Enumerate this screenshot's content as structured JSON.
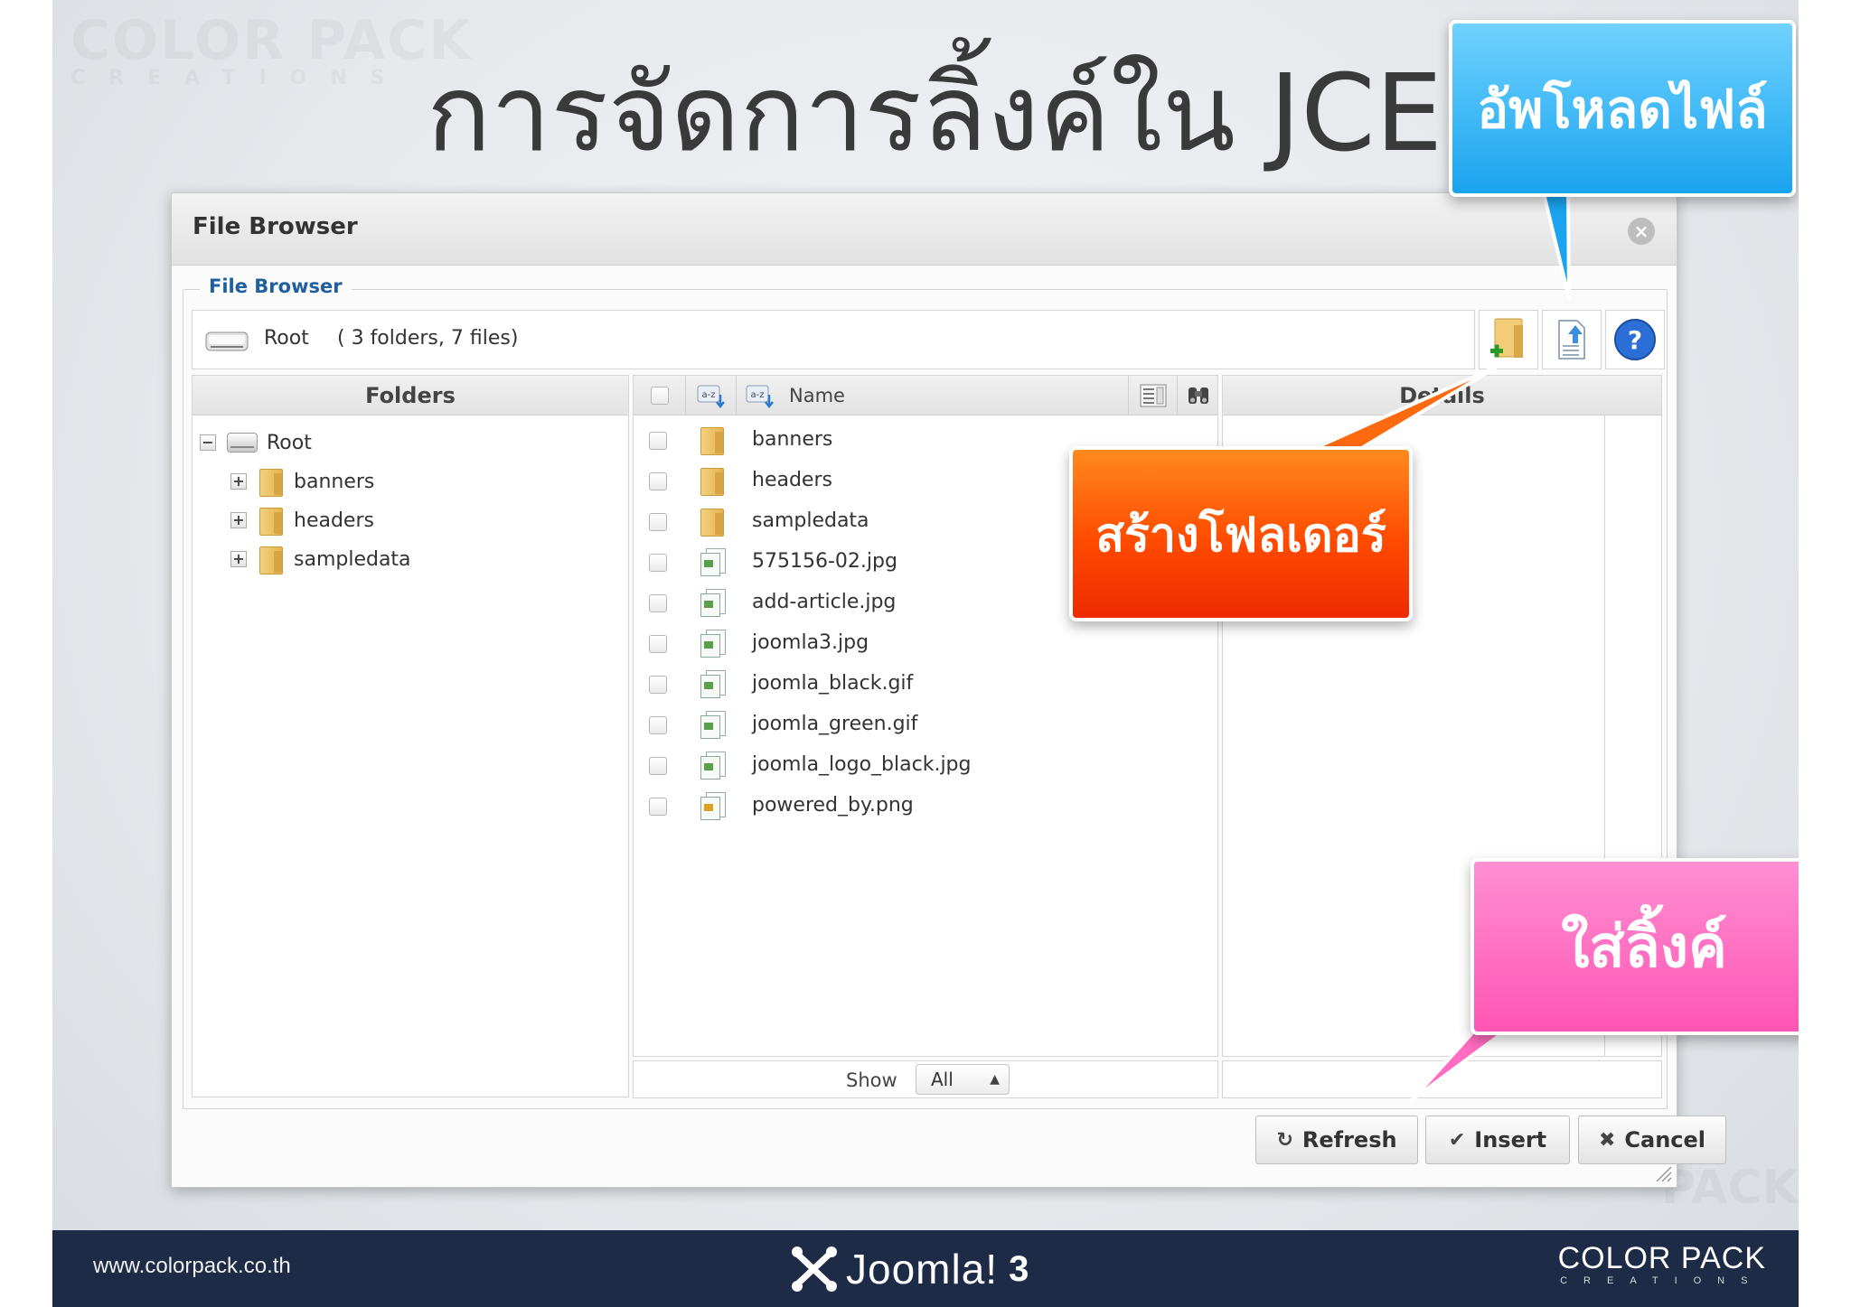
{
  "slide": {
    "title": "การจัดการลิ้งค์ใน JCE",
    "watermark_top": "COLOR PACK",
    "watermark_top_sub": "CREATIONS",
    "watermark_bottom": "PACK"
  },
  "dialog": {
    "title": "File Browser",
    "legend": "File Browser",
    "path": {
      "root": "Root",
      "count": "( 3 folders, 7 files)"
    },
    "folders_header": "Folders",
    "details_header": "Details",
    "name_header": "Name",
    "tree": [
      {
        "label": "Root",
        "toggle": "−"
      },
      {
        "label": "banners",
        "toggle": "+"
      },
      {
        "label": "headers",
        "toggle": "+"
      },
      {
        "label": "sampledata",
        "toggle": "+"
      }
    ],
    "files": [
      {
        "name": "banners",
        "type": "folder"
      },
      {
        "name": "headers",
        "type": "folder"
      },
      {
        "name": "sampledata",
        "type": "folder"
      },
      {
        "name": "575156-02.jpg",
        "type": "image"
      },
      {
        "name": "add-article.jpg",
        "type": "image"
      },
      {
        "name": "joomla3.jpg",
        "type": "image"
      },
      {
        "name": "joomla_black.gif",
        "type": "image"
      },
      {
        "name": "joomla_green.gif",
        "type": "image"
      },
      {
        "name": "joomla_logo_black.jpg",
        "type": "image"
      },
      {
        "name": "powered_by.png",
        "type": "image-alt"
      }
    ],
    "show": {
      "label": "Show",
      "value": "All"
    },
    "buttons": {
      "refresh": "Refresh",
      "insert": "Insert",
      "cancel": "Cancel"
    }
  },
  "callouts": {
    "upload": "อัพโหลดไฟล์",
    "new_folder": "สร้างโฟลเดอร์",
    "insert": "ใส่ลิ้งค์"
  },
  "footer": {
    "url": "www.colorpack.co.th",
    "joomla": "Joomla!",
    "joomla_version": "3",
    "brand": "COLOR PACK",
    "brand_sub": "CREATIONS"
  },
  "colors": {
    "upload_callout": "#1aa4ef",
    "folder_callout": "#ff4a00",
    "insert_callout": "#ff55b4",
    "legend_blue": "#1f5f9e",
    "footer_bg": "#1d2b46"
  },
  "icons": [
    "close-icon",
    "drive-icon",
    "new-folder-icon",
    "upload-icon",
    "help-icon",
    "folder-icon",
    "image-file-icon",
    "refresh-icon",
    "check-icon",
    "x-icon"
  ]
}
